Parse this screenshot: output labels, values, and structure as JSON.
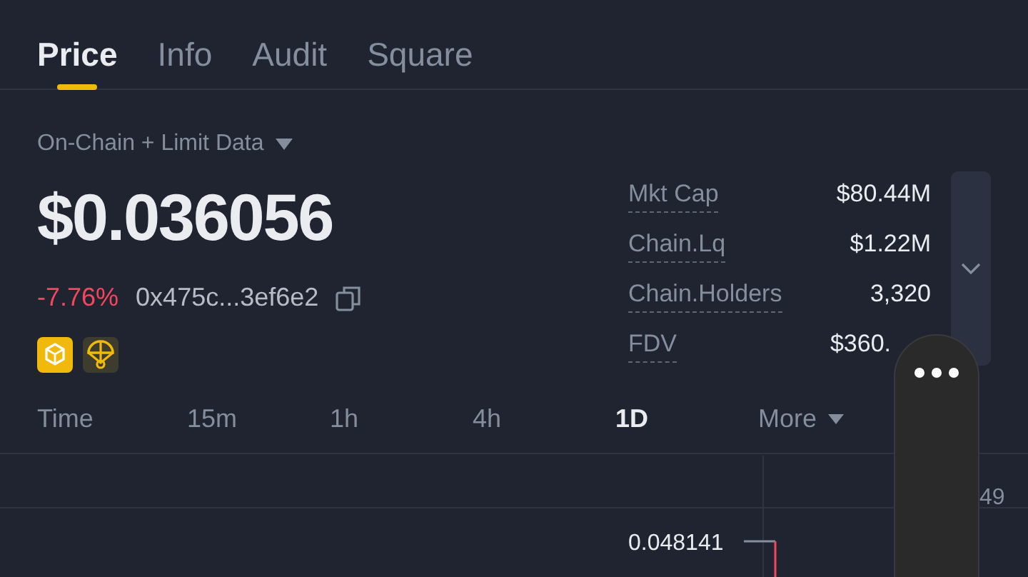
{
  "tabs": [
    {
      "label": "Price",
      "selected": true
    },
    {
      "label": "Info",
      "selected": false
    },
    {
      "label": "Audit",
      "selected": false
    },
    {
      "label": "Square",
      "selected": false
    }
  ],
  "data_source": "On-Chain + Limit Data",
  "price": "$0.036056",
  "change": "-7.76%",
  "address": "0x475c...3ef6e2",
  "stats": [
    {
      "label": "Mkt Cap",
      "value": "$80.44M"
    },
    {
      "label": "Chain.Lq",
      "value": "$1.22M"
    },
    {
      "label": "Chain.Holders",
      "value": "3,320"
    },
    {
      "label": "FDV",
      "value": "$360.",
      "clipped": true
    }
  ],
  "intervals": [
    {
      "label": "Time",
      "selected": false,
      "kind": "label"
    },
    {
      "label": "15m",
      "selected": false,
      "kind": "option"
    },
    {
      "label": "1h",
      "selected": false,
      "kind": "option"
    },
    {
      "label": "4h",
      "selected": false,
      "kind": "option"
    },
    {
      "label": "1D",
      "selected": true,
      "kind": "option"
    },
    {
      "label": "More",
      "selected": false,
      "kind": "dropdown"
    }
  ],
  "chart": {
    "axis_label": "49",
    "high_label": "0.048141"
  }
}
